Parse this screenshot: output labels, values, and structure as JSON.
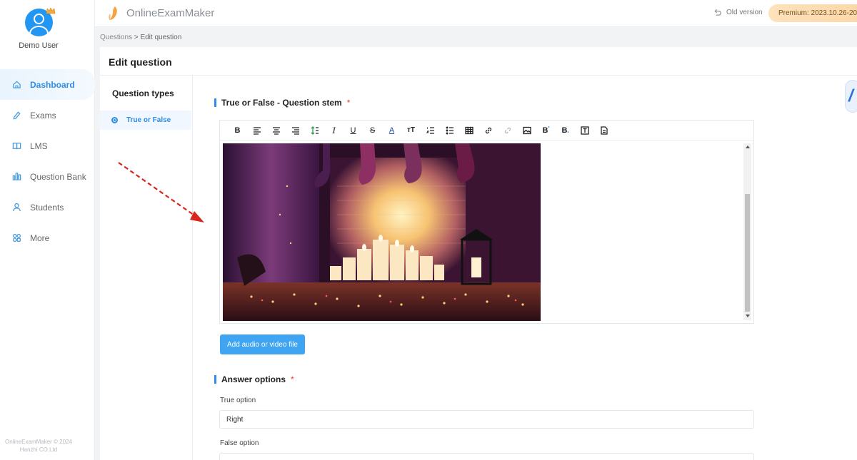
{
  "user": {
    "name": "Demo User"
  },
  "nav": [
    {
      "label": "Dashboard",
      "icon": "home-icon",
      "active": true
    },
    {
      "label": "Exams",
      "icon": "exams-icon"
    },
    {
      "label": "LMS",
      "icon": "book-icon"
    },
    {
      "label": "Question Bank",
      "icon": "chart-icon"
    },
    {
      "label": "Students",
      "icon": "user-icon"
    },
    {
      "label": "More",
      "icon": "grid-icon"
    }
  ],
  "footer": {
    "line1": "OnlineExamMaker © 2024",
    "line2": "Hanzhi CO.Ltd"
  },
  "header": {
    "brand": "OnlineExamMaker",
    "old_version": "Old version",
    "premium": "Premium:  2023.10.26-20"
  },
  "breadcrumb": {
    "parent": "Questions",
    "separator": " > ",
    "current": "Edit question"
  },
  "page": {
    "title": "Edit question"
  },
  "question_types": {
    "label": "Question types",
    "selected": "True or False"
  },
  "stem": {
    "title": "True or False - Question stem",
    "required": "*"
  },
  "toolbar": {
    "bold": "B",
    "italic": "I",
    "underline": "U",
    "strike": "S",
    "font_color": "A",
    "font_size": "тT",
    "superscript": "B",
    "subscript": "B"
  },
  "media_button": "Add audio or video file",
  "answers": {
    "title": "Answer options",
    "required": "*",
    "true_label": "True option",
    "true_value": "Right",
    "false_label": "False option"
  },
  "colors": {
    "accent": "#2f8de4",
    "button": "#3fa4f1",
    "required": "#e0402f",
    "arrow": "#d9261c"
  }
}
